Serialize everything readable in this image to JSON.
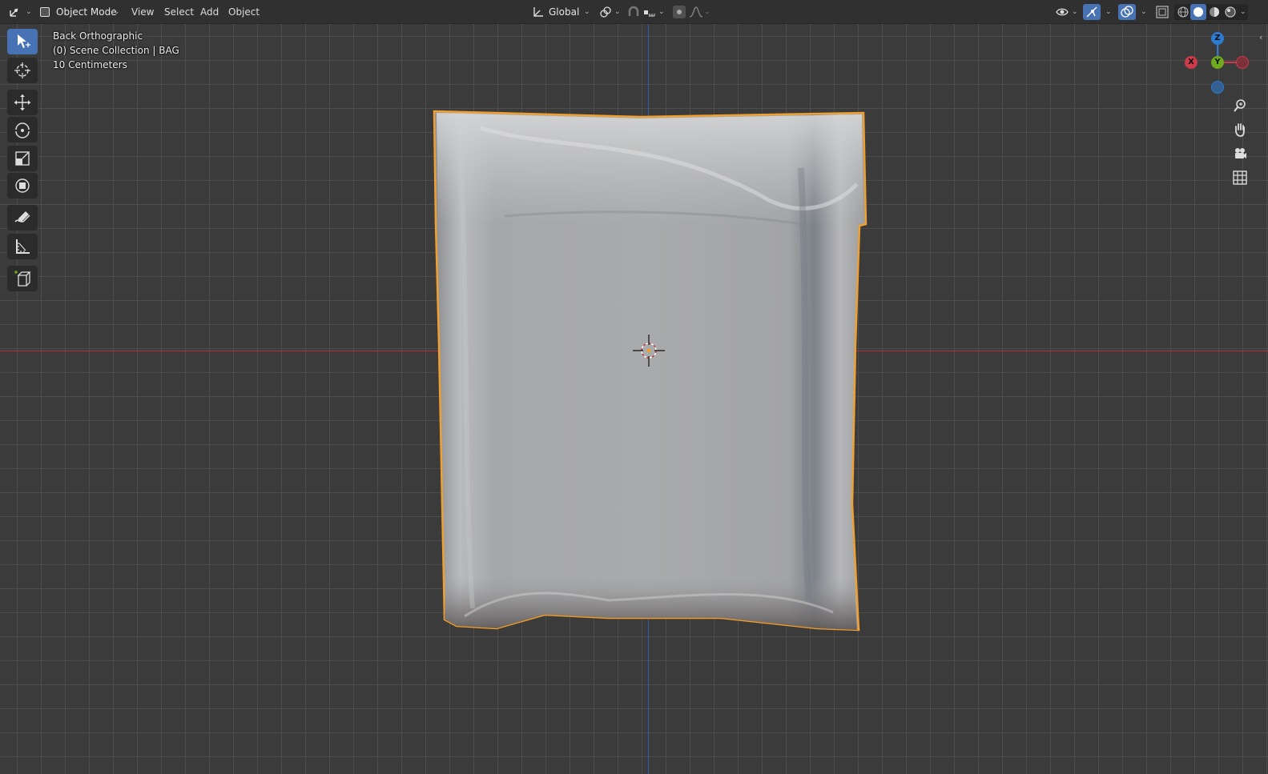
{
  "header": {
    "mode_label": "Object Mode",
    "menu": [
      "View",
      "Select",
      "Add",
      "Object"
    ],
    "transform_orientation": "Global"
  },
  "viewport": {
    "view_name": "Back Orthographic",
    "collection_info": "(0) Scene Collection | BAG",
    "grid_scale": "10 Centimeters"
  },
  "gizmo": {
    "x_label": "X",
    "y_label": "Y",
    "z_label": "Z"
  },
  "colors": {
    "header_bg": "#303030",
    "viewport_bg": "#3b3b3b",
    "active_tool": "#4772b3",
    "x_axis": "#cc3b4b",
    "y_axis": "#6ea91f",
    "z_axis": "#2d7bd1",
    "selection_outline": "#f0a030"
  },
  "toolbar": {
    "tools": [
      "select-box",
      "cursor",
      "move",
      "rotate",
      "scale",
      "transform",
      "annotate",
      "measure",
      "add-cube"
    ],
    "active_tool": "select-box"
  },
  "icons": {
    "header": [
      "editor-type-icon",
      "object-mode-icon",
      "orientation-icon",
      "pivot-icon",
      "snap-icon",
      "snap-increment-icon",
      "proportional-edit-icon",
      "falloff-icon",
      "visibility-icon",
      "gizmo-icon",
      "overlay-icon",
      "xray-icon",
      "wireframe-shading-icon",
      "solid-shading-icon",
      "material-shading-icon",
      "rendered-shading-icon"
    ],
    "navigation": [
      "zoom-icon",
      "pan-hand-icon",
      "camera-icon",
      "grid-icon"
    ]
  }
}
